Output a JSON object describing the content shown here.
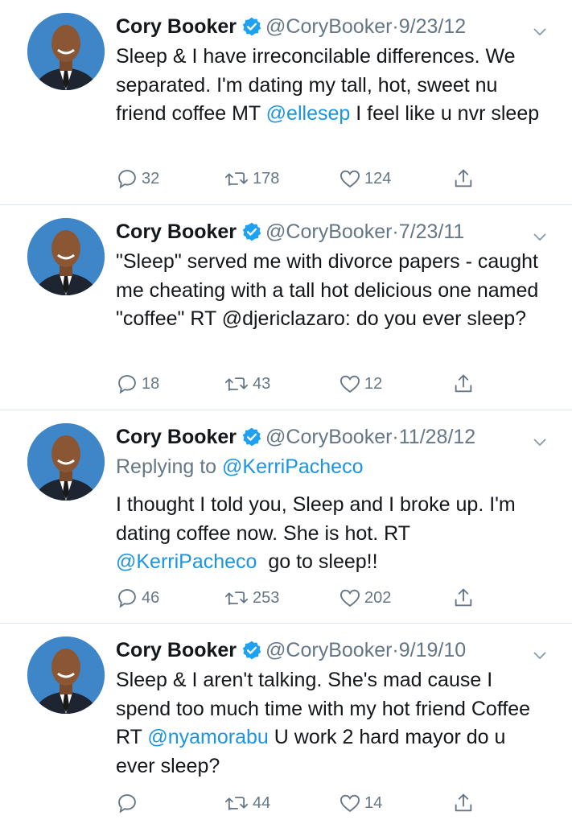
{
  "tweets": [
    {
      "name": "Cory Booker",
      "handle": "@CoryBooker",
      "dot": "·",
      "date": "9/23/12",
      "body_before": "Sleep & I have irreconcilable differences. We separated. I'm dating my tall, hot, sweet nu friend coffee MT ",
      "mention1": "@ellesep",
      "body_after": " I feel like u nvr sleep",
      "replies": "32",
      "retweets": "178",
      "likes": "124"
    },
    {
      "name": "Cory Booker",
      "handle": "@CoryBooker",
      "dot": "·",
      "date": "7/23/11",
      "body_before": "\"Sleep\" served me with divorce papers - caught me cheating with a tall hot delicious one named \"coffee\" RT @djericlazaro: do you ever sleep?",
      "replies": "18",
      "retweets": "43",
      "likes": "12"
    },
    {
      "name": "Cory Booker",
      "handle": "@CoryBooker",
      "dot": "·",
      "date": "11/28/12",
      "replying_prefix": "Replying to ",
      "replying_to": "@KerriPacheco",
      "body_before": "I thought I told you, Sleep and I broke up. I'm dating coffee now. She is hot. RT\n",
      "mention1": "@KerriPacheco",
      "body_after": "  go to sleep!!",
      "replies": "46",
      "retweets": "253",
      "likes": "202"
    },
    {
      "name": "Cory Booker",
      "handle": "@CoryBooker",
      "dot": "·",
      "date": "9/19/10",
      "body_before": "Sleep & I aren't talking. She's mad cause I spend too much time with my hot friend Coffee RT ",
      "mention1": "@nyamorabu",
      "body_after": " U work 2 hard mayor do u ever sleep?",
      "replies": "",
      "retweets": "44",
      "likes": "14"
    }
  ],
  "icons": {
    "reply": "reply-icon",
    "retweet": "retweet-icon",
    "like": "heart-icon",
    "share": "share-icon",
    "verified": "verified-badge-icon",
    "caret": "chevron-down-icon"
  },
  "colors": {
    "text": "#14171a",
    "secondary": "#657786",
    "link": "#1b95e0",
    "verified": "#1da1f2",
    "divider": "#e1e8ed",
    "avatar_bg": "#3f86c8"
  }
}
